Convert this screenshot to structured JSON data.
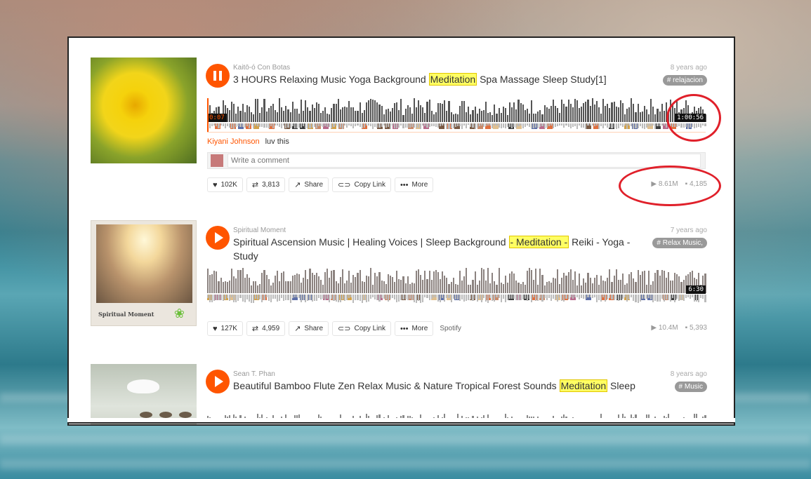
{
  "tracks": [
    {
      "user": "Kaitō-ó Con Botas",
      "title_pre": "3 HOURS Relaxing Music Yoga Background ",
      "title_hl": "Meditation",
      "title_post": " Spa Massage Sleep Study[1]",
      "age": "8 years ago",
      "tag": "# relajacion",
      "state": "playing",
      "current_time": "0:07",
      "duration": "1:00:56",
      "comment": {
        "author": "Kiyani Johnson",
        "text": "luv this"
      },
      "comment_placeholder": "Write a comment",
      "likes": "102K",
      "reposts": "3,813",
      "share": "Share",
      "copy_link": "Copy Link",
      "more": "More",
      "plays": "8.61M",
      "comments": "4,185"
    },
    {
      "user": "Spiritual Moment",
      "title_pre": "Spiritual Ascension Music | Healing Voices | Sleep Background ",
      "title_hl": "- Meditation -",
      "title_post": " Reiki - Yoga - Study",
      "age": "7 years ago",
      "tag": "# Relax Music,",
      "state": "paused",
      "duration": "6:30",
      "art_caption": "Spiritual Moment",
      "likes": "127K",
      "reposts": "4,959",
      "share": "Share",
      "copy_link": "Copy Link",
      "more": "More",
      "extra": "Spotify",
      "plays": "10.4M",
      "comments": "5,393"
    },
    {
      "user": "Sean T. Phan",
      "title_pre": "Beautiful Bamboo Flute Zen Relax Music & Nature Tropical Forest Sounds ",
      "title_hl": "Meditation",
      "title_post": " Sleep",
      "age": "8 years ago",
      "tag": "# Music",
      "state": "paused"
    }
  ],
  "colors": {
    "accent": "#ff5500",
    "highlight": "#ffff63",
    "annotation": "#e0202a"
  }
}
